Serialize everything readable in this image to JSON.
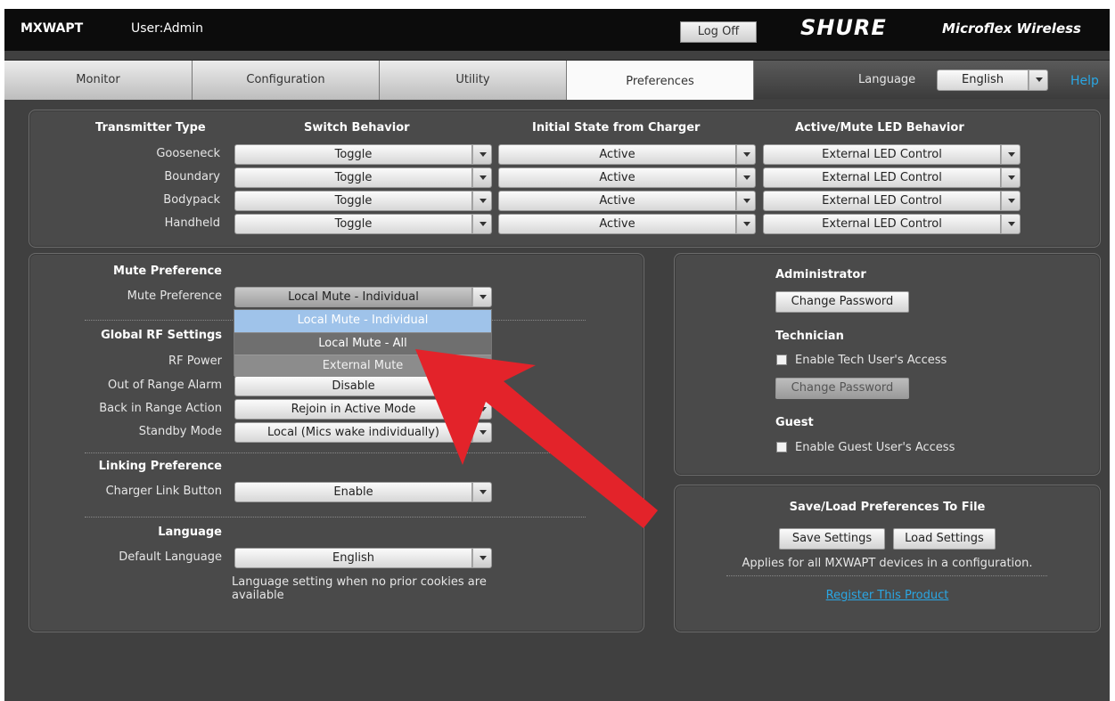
{
  "header": {
    "device": "MXWAPT",
    "user": "User:Admin",
    "logoff_label": "Log Off",
    "brand": "SHURE",
    "product": "Microflex Wireless"
  },
  "tabs": [
    {
      "label": "Monitor",
      "active": false
    },
    {
      "label": "Configuration",
      "active": false
    },
    {
      "label": "Utility",
      "active": false
    },
    {
      "label": "Preferences",
      "active": true
    }
  ],
  "language_bar": {
    "label": "Language",
    "value": "English",
    "help": "Help"
  },
  "transmitter_table": {
    "headers": [
      "Transmitter Type",
      "Switch Behavior",
      "Initial State from Charger",
      "Active/Mute LED Behavior"
    ],
    "rows": [
      {
        "type": "Gooseneck",
        "switch": "Toggle",
        "initial": "Active",
        "led": "External LED Control"
      },
      {
        "type": "Boundary",
        "switch": "Toggle",
        "initial": "Active",
        "led": "External LED Control"
      },
      {
        "type": "Bodypack",
        "switch": "Toggle",
        "initial": "Active",
        "led": "External LED Control"
      },
      {
        "type": "Handheld",
        "switch": "Toggle",
        "initial": "Active",
        "led": "External LED Control"
      }
    ]
  },
  "mute_preference": {
    "heading": "Mute Preference",
    "label": "Mute Preference",
    "value": "Local Mute - Individual",
    "options": [
      {
        "label": "Local Mute - Individual",
        "state": "selected"
      },
      {
        "label": "Local Mute - All",
        "state": "hover"
      },
      {
        "label": "External Mute",
        "state": "normal"
      }
    ]
  },
  "global_rf": {
    "heading": "Global RF Settings",
    "rf_power_label": "RF Power",
    "out_of_range_label": "Out of Range Alarm",
    "out_of_range_value": "Disable",
    "back_in_range_label": "Back in Range Action",
    "back_in_range_value": "Rejoin in Active Mode",
    "standby_label": "Standby Mode",
    "standby_value": "Local (Mics wake individually)"
  },
  "linking": {
    "heading": "Linking Preference",
    "label": "Charger Link Button",
    "value": "Enable"
  },
  "language_pref": {
    "heading": "Language",
    "label": "Default Language",
    "value": "English",
    "note": "Language setting when no prior cookies are available"
  },
  "accounts": {
    "admin_heading": "Administrator",
    "admin_button": "Change Password",
    "tech_heading": "Technician",
    "tech_checkbox": "Enable Tech User's Access",
    "tech_button": "Change Password",
    "guest_heading": "Guest",
    "guest_checkbox": "Enable Guest User's Access"
  },
  "save_load": {
    "heading": "Save/Load Preferences To File",
    "save_button": "Save Settings",
    "load_button": "Load Settings",
    "note": "Applies for all MXWAPT devices in a configuration.",
    "register_link": "Register This Product"
  },
  "colors": {
    "background": "#404040",
    "topbar": "#0c0c0c",
    "link": "#2aa7e4",
    "annotation_arrow": "#e3232a",
    "selected_option": "#9fc3ea"
  }
}
